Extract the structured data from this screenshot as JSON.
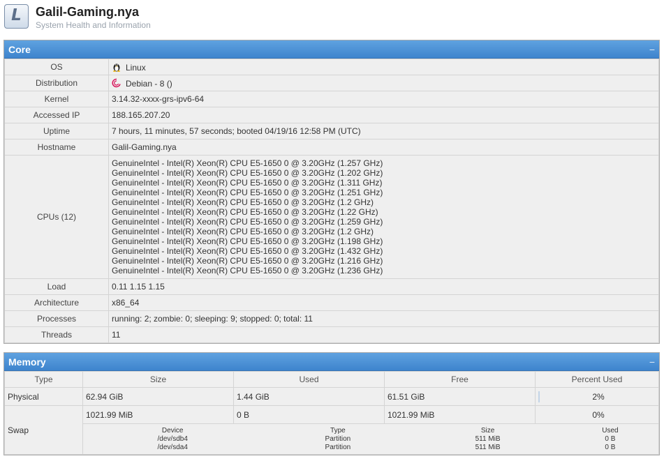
{
  "header": {
    "logo_letter": "L",
    "title": "Galil-Gaming.nya",
    "subtitle": "System Health and Information"
  },
  "core": {
    "title": "Core",
    "collapse": "−",
    "rows": [
      {
        "label": "OS",
        "value": "Linux"
      },
      {
        "label": "Distribution",
        "value": "Debian - 8 ()"
      },
      {
        "label": "Kernel",
        "value": "3.14.32-xxxx-grs-ipv6-64"
      },
      {
        "label": "Accessed IP",
        "value": "188.165.207.20"
      },
      {
        "label": "Uptime",
        "value": "7 hours, 11 minutes, 57 seconds; booted 04/19/16 12:58 PM (UTC)"
      },
      {
        "label": "Hostname",
        "value": "Galil-Gaming.nya"
      }
    ],
    "cpus_label": "CPUs (12)",
    "cpus": [
      "GenuineIntel - Intel(R) Xeon(R) CPU E5-1650 0 @ 3.20GHz (1.257 GHz)",
      "GenuineIntel - Intel(R) Xeon(R) CPU E5-1650 0 @ 3.20GHz (1.202 GHz)",
      "GenuineIntel - Intel(R) Xeon(R) CPU E5-1650 0 @ 3.20GHz (1.311 GHz)",
      "GenuineIntel - Intel(R) Xeon(R) CPU E5-1650 0 @ 3.20GHz (1.251 GHz)",
      "GenuineIntel - Intel(R) Xeon(R) CPU E5-1650 0 @ 3.20GHz (1.2 GHz)",
      "GenuineIntel - Intel(R) Xeon(R) CPU E5-1650 0 @ 3.20GHz (1.22 GHz)",
      "GenuineIntel - Intel(R) Xeon(R) CPU E5-1650 0 @ 3.20GHz (1.259 GHz)",
      "GenuineIntel - Intel(R) Xeon(R) CPU E5-1650 0 @ 3.20GHz (1.2 GHz)",
      "GenuineIntel - Intel(R) Xeon(R) CPU E5-1650 0 @ 3.20GHz (1.198 GHz)",
      "GenuineIntel - Intel(R) Xeon(R) CPU E5-1650 0 @ 3.20GHz (1.432 GHz)",
      "GenuineIntel - Intel(R) Xeon(R) CPU E5-1650 0 @ 3.20GHz (1.216 GHz)",
      "GenuineIntel - Intel(R) Xeon(R) CPU E5-1650 0 @ 3.20GHz (1.236 GHz)"
    ],
    "rows_after": [
      {
        "label": "Load",
        "value": "0.11 1.15 1.15"
      },
      {
        "label": "Architecture",
        "value": "x86_64"
      },
      {
        "label": "Processes",
        "value": "running: 2; zombie: 0; sleeping: 9; stopped: 0; total: 11"
      },
      {
        "label": "Threads",
        "value": "11"
      }
    ],
    "os_icon": "linux-penguin-icon",
    "distro_icon": "debian-swirl-icon"
  },
  "memory": {
    "title": "Memory",
    "collapse": "−",
    "headers": [
      "Type",
      "Size",
      "Used",
      "Free",
      "Percent Used"
    ],
    "physical": {
      "type": "Physical",
      "size": "62.94 GiB",
      "used": "1.44 GiB",
      "free": "61.51 GiB",
      "percent": "2%",
      "percent_value": 2
    },
    "swap": {
      "type": "Swap",
      "size": "1021.99 MiB",
      "used": "0 B",
      "free": "1021.99 MiB",
      "percent": "0%",
      "percent_value": 0
    },
    "swap_devices_headers": [
      "Device",
      "Type",
      "Size",
      "Used"
    ],
    "swap_devices": [
      {
        "device": "/dev/sdb4",
        "type": "Partition",
        "size": "511 MiB",
        "used": "0 B"
      },
      {
        "device": "/dev/sda4",
        "type": "Partition",
        "size": "511 MiB",
        "used": "0 B"
      }
    ]
  },
  "colors": {
    "header_blue": "#4a90d9",
    "debian_red": "#d70a53"
  }
}
